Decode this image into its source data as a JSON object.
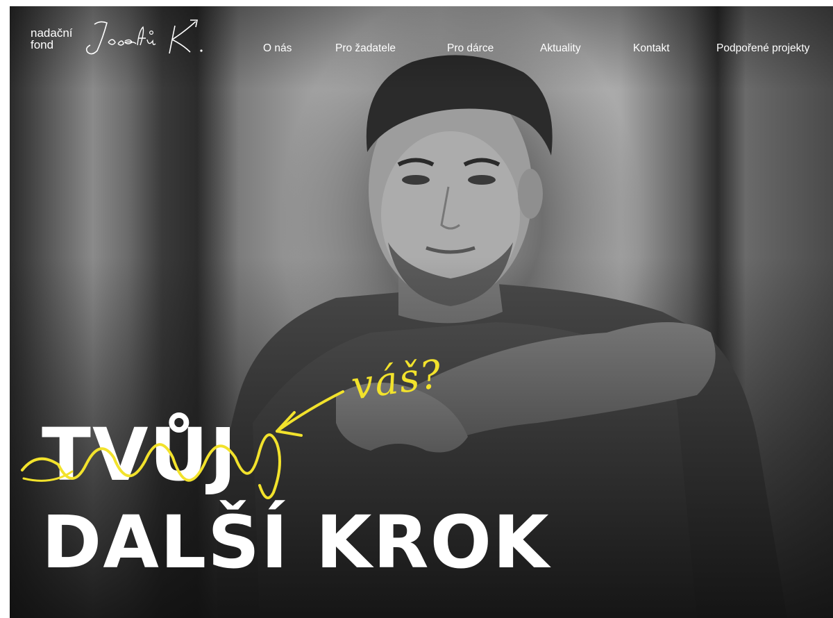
{
  "header": {
    "logo": {
      "small_line1": "nadační",
      "small_line2": "fond",
      "script_text": "Josefů K."
    },
    "nav": [
      {
        "label": "O nás"
      },
      {
        "label": "Pro žadatele"
      },
      {
        "label": "Pro dárce"
      },
      {
        "label": "Aktuality"
      },
      {
        "label": "Kontakt"
      },
      {
        "label": "Podpořené projekty"
      }
    ]
  },
  "hero": {
    "headline_line1": "TVŮJ",
    "headline_line2": "DALŠÍ KROK",
    "handwritten_note": "váš?",
    "accent_color": "#f2e22c"
  }
}
